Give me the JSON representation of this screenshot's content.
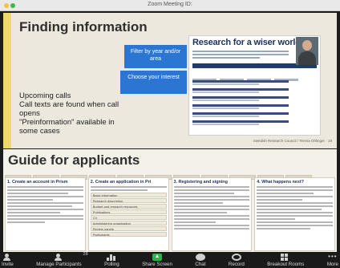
{
  "window": {
    "title": "Zoom Meeting ID:"
  },
  "slide1": {
    "heading": "Finding information",
    "callout_filter": "Filter by year and/or area",
    "callout_interest": "Choose your interest",
    "body": "Upcoming calls\nCall texts are found when call opens\n\"Preinformation\" available in some cases",
    "website": {
      "title": "Research for a wiser world"
    },
    "footer": "Swedish Research Council / Teresa Ohlinger · 19"
  },
  "slide2": {
    "heading": "Guide for applicants",
    "columns": [
      {
        "title": "1. Create an account in Prism"
      },
      {
        "title": "2. Create an application in Pri",
        "items": [
          "Basic information",
          "Research description",
          "Budget and research resources",
          "Publications",
          "CV",
          "Administering organisation",
          "Review panels",
          "Participants"
        ]
      },
      {
        "title": "3. Registering and signing"
      },
      {
        "title": "4. What happens next?"
      }
    ]
  },
  "toolbar": {
    "items": [
      {
        "label": "Invite",
        "icon": "invite-icon"
      },
      {
        "label": "Manage Participants",
        "icon": "participants-icon",
        "count": "28"
      },
      {
        "label": "Polling",
        "icon": "polling-icon"
      },
      {
        "label": "Share Screen",
        "icon": "share-screen-icon"
      },
      {
        "label": "Chat",
        "icon": "chat-icon"
      },
      {
        "label": "Record",
        "icon": "record-icon"
      },
      {
        "label": "Breakout Rooms",
        "icon": "breakout-rooms-icon"
      },
      {
        "label": "More",
        "icon": "more-icon"
      }
    ]
  }
}
